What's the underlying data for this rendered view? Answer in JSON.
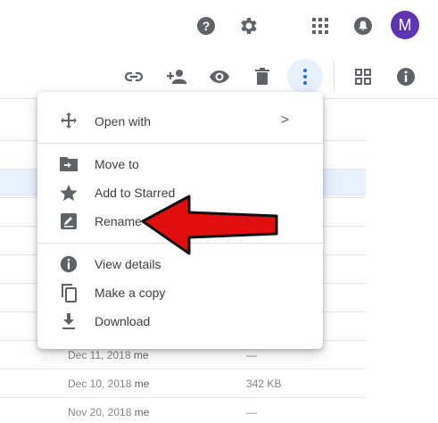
{
  "header": {
    "help_icon": "help-icon",
    "settings_icon": "gear-icon",
    "apps_icon": "apps-grid-icon",
    "notifications_icon": "bell-icon",
    "avatar_letter": "M",
    "avatar_color": "#5e35b1"
  },
  "toolbar": {
    "icons": [
      "link-icon",
      "add-person-icon",
      "eye-icon",
      "trash-icon",
      "more-vert-icon",
      "grid-view-icon",
      "info-icon"
    ],
    "accent": "#1a73e8"
  },
  "context_menu": {
    "items": [
      {
        "label": "Open with",
        "icon": "move-arrows-icon",
        "has_submenu": true
      },
      {
        "label": "Move to",
        "icon": "folder-move-icon"
      },
      {
        "label": "Add to Starred",
        "icon": "star-icon"
      },
      {
        "label": "Rename",
        "icon": "pencil-icon"
      },
      {
        "label": "View details",
        "icon": "info-icon"
      },
      {
        "label": "Make a copy",
        "icon": "copy-icon"
      },
      {
        "label": "Download",
        "icon": "download-icon"
      }
    ],
    "submenu_chevron": ">"
  },
  "file_rows": [
    {
      "date": "Dec 11, 2018",
      "owner": "me",
      "size": "—"
    },
    {
      "date": "Dec 10, 2018",
      "owner": "me",
      "size": "342 KB"
    },
    {
      "date": "Nov 20, 2018",
      "owner": "me",
      "size": "—"
    }
  ],
  "annotation": {
    "arrow_color": "#e10f0f"
  }
}
